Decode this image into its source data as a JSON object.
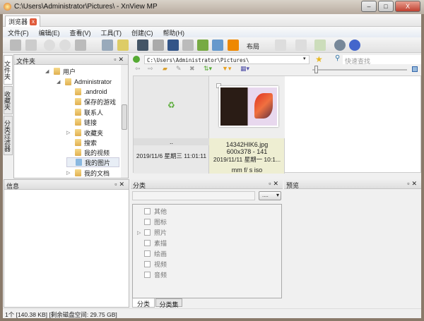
{
  "window": {
    "title": "C:\\Users\\Administrator\\Pictures\\ - XnView MP",
    "min": "–",
    "max": "□",
    "close": "X"
  },
  "doc_tab": {
    "label": "浏览器",
    "close": "x"
  },
  "menu": [
    "文件(F)",
    "编辑(E)",
    "查看(V)",
    "工具(T)",
    "创建(C)",
    "帮助(H)"
  ],
  "toolbar": {
    "layout_label": "布局"
  },
  "side_tabs": [
    "文件夹",
    "收藏夹",
    "分类过滤器"
  ],
  "folder_panel": {
    "title": "文件夹",
    "items": [
      {
        "label": "用户",
        "arrow": "◢"
      },
      {
        "label": "Administrator",
        "arrow": "◢"
      },
      {
        "label": ".android",
        "arrow": ""
      },
      {
        "label": "保存的游戏",
        "arrow": ""
      },
      {
        "label": "联系人",
        "arrow": ""
      },
      {
        "label": "链接",
        "arrow": ""
      },
      {
        "label": "收藏夹",
        "arrow": "▷"
      },
      {
        "label": "搜索",
        "arrow": ""
      },
      {
        "label": "我的视频",
        "arrow": ""
      },
      {
        "label": "我的图片",
        "arrow": ""
      },
      {
        "label": "我的文档",
        "arrow": "▷"
      }
    ]
  },
  "browser": {
    "path": "C:\\Users\\Administrator\\Pictures\\",
    "search_placeholder": "快速查找",
    "items": [
      {
        "name": "..",
        "date": "2019/11/6 星期三 11:01:11"
      },
      {
        "name": "14342HIK6.jpg",
        "dims": "600x378 - 141",
        "date": "2019/11/11 星期一 10:1...",
        "exif": "mm f/ s iso"
      }
    ]
  },
  "info_panel": {
    "title": "信息"
  },
  "category_panel": {
    "title": "分类",
    "dropdown": "....",
    "items": [
      "其他",
      "图标",
      "照片",
      "素描",
      "绘画",
      "视频",
      "音频"
    ],
    "tabs": [
      "分类",
      "分类集"
    ]
  },
  "preview_panel": {
    "title": "预览"
  },
  "status": "1个 [140.38 KB] [剩余磁盘空间: 29.75 GB]"
}
